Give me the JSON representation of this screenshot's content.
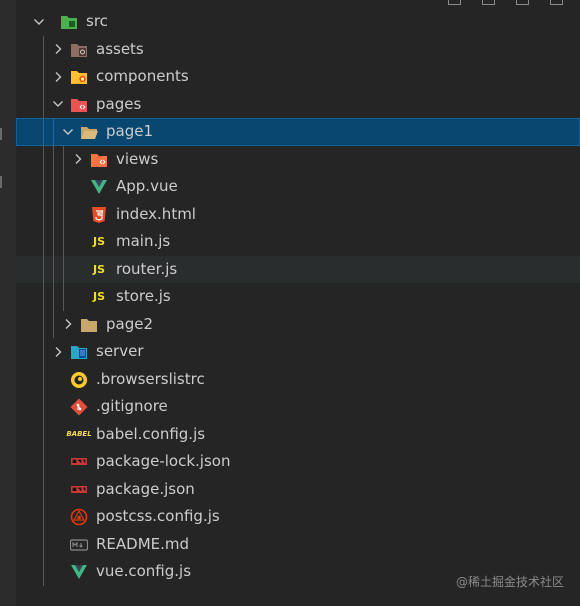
{
  "tree": [
    {
      "label": "src",
      "depth": 0,
      "kind": "folder",
      "expanded": true,
      "icon": "folder-src-icon",
      "color": "#4caf50"
    },
    {
      "label": "assets",
      "depth": 1,
      "kind": "folder",
      "expanded": false,
      "icon": "folder-assets-icon",
      "color": "#8d6e63"
    },
    {
      "label": "components",
      "depth": 1,
      "kind": "folder",
      "expanded": false,
      "icon": "folder-components-icon",
      "color": "#fbc02d"
    },
    {
      "label": "pages",
      "depth": 1,
      "kind": "folder",
      "expanded": true,
      "icon": "folder-pages-icon",
      "color": "#ef5350"
    },
    {
      "label": "page1",
      "depth": 2,
      "kind": "folder",
      "expanded": true,
      "icon": "folder-open-icon",
      "color": "#c9a66b",
      "selected": true
    },
    {
      "label": "views",
      "depth": 3,
      "kind": "folder",
      "expanded": false,
      "icon": "folder-views-icon",
      "color": "#ff7043"
    },
    {
      "label": "App.vue",
      "depth": 3,
      "kind": "file",
      "icon": "vue-icon",
      "color": "#41b883"
    },
    {
      "label": "index.html",
      "depth": 3,
      "kind": "file",
      "icon": "html5-icon",
      "color": "#e44d26"
    },
    {
      "label": "main.js",
      "depth": 3,
      "kind": "file",
      "icon": "js-icon",
      "color": "#f5de19",
      "badge": "JS"
    },
    {
      "label": "router.js",
      "depth": 3,
      "kind": "file",
      "icon": "js-icon",
      "color": "#f5de19",
      "badge": "JS",
      "hover": true
    },
    {
      "label": "store.js",
      "depth": 3,
      "kind": "file",
      "icon": "js-icon",
      "color": "#f5de19",
      "badge": "JS"
    },
    {
      "label": "page2",
      "depth": 2,
      "kind": "folder",
      "expanded": false,
      "icon": "folder-icon",
      "color": "#c9a66b"
    },
    {
      "label": "server",
      "depth": 1,
      "kind": "folder",
      "expanded": false,
      "icon": "folder-server-icon",
      "color": "#26a9c5"
    },
    {
      "label": ".browserslistrc",
      "depth": 1,
      "kind": "file",
      "icon": "browserslist-icon",
      "color": "#ffca28"
    },
    {
      "label": ".gitignore",
      "depth": 1,
      "kind": "file",
      "icon": "git-icon",
      "color": "#e44d3a"
    },
    {
      "label": "babel.config.js",
      "depth": 1,
      "kind": "file",
      "icon": "babel-icon",
      "color": "#f5da55",
      "badge": "BABEL"
    },
    {
      "label": "package-lock.json",
      "depth": 1,
      "kind": "file",
      "icon": "npm-icon",
      "color": "#cb3837",
      "badge": "npm"
    },
    {
      "label": "package.json",
      "depth": 1,
      "kind": "file",
      "icon": "npm-icon",
      "color": "#cb3837",
      "badge": "npm"
    },
    {
      "label": "postcss.config.js",
      "depth": 1,
      "kind": "file",
      "icon": "postcss-icon",
      "color": "#dd3a0a"
    },
    {
      "label": "README.md",
      "depth": 1,
      "kind": "file",
      "icon": "markdown-icon",
      "color": "#8a8a8a",
      "badge": "M+"
    },
    {
      "label": "vue.config.js",
      "depth": 1,
      "kind": "file",
      "icon": "vue-config-icon",
      "color": "#41b883"
    }
  ],
  "watermark": "@稀土掘金技术社区",
  "colors": {
    "background": "#252526",
    "selected": "#094771",
    "hover": "#2a2d2e",
    "text": "#cccccc"
  }
}
